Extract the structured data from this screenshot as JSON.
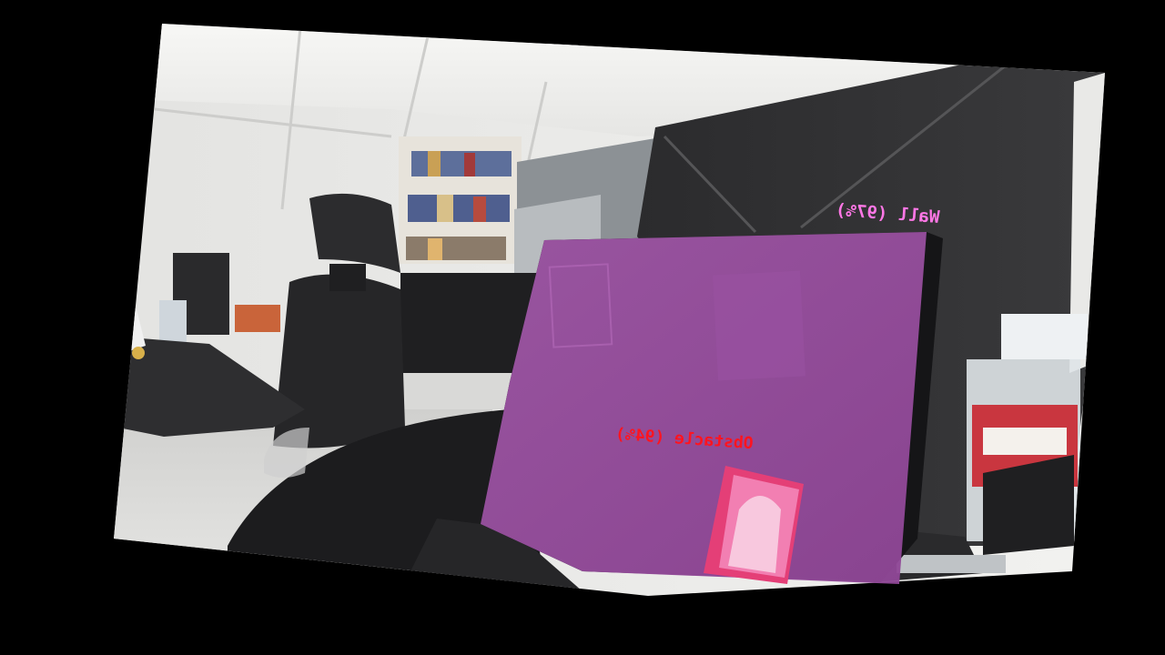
{
  "detections": [
    {
      "id": "wall",
      "label": "Wall (97%)",
      "color": "#ff77e6"
    },
    {
      "id": "obstacle",
      "label": "Obstacle (94%)",
      "color": "#ff1420"
    }
  ],
  "colors": {
    "background": "#000000",
    "wall_mask": "#9b4fa2",
    "obstacle_mask": "#f0669a"
  }
}
